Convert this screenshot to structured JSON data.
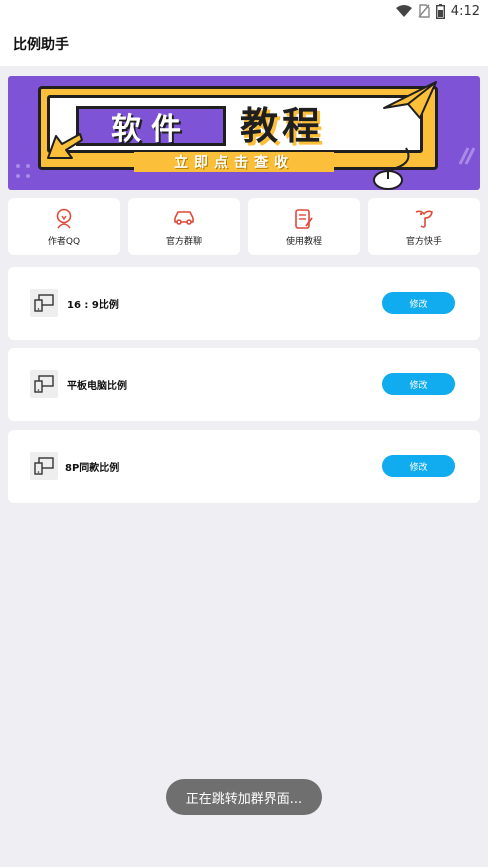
{
  "status_bar": {
    "time": "4:12",
    "icons": [
      "wifi-icon",
      "no-sim-icon",
      "battery-icon"
    ]
  },
  "app_bar": {
    "title": "比例助手"
  },
  "banner": {
    "title_left": "软件",
    "title_right": "教程",
    "cta": "立即点击查收",
    "colors": {
      "background": "#7f53d6",
      "accent": "#fbbf3a"
    }
  },
  "quick_actions": [
    {
      "label": "作者QQ",
      "icon": "user-icon"
    },
    {
      "label": "官方群聊",
      "icon": "car-icon"
    },
    {
      "label": "使用教程",
      "icon": "document-edit-icon"
    },
    {
      "label": "官方快手",
      "icon": "kuaishou-icon"
    }
  ],
  "ratio_items": [
    {
      "title": "16 : 9比例",
      "button": "修改",
      "icon": "devices-icon"
    },
    {
      "title": "平板电脑比例",
      "button": "修改",
      "icon": "devices-icon"
    },
    {
      "title": "8P同款比例",
      "button": "修改",
      "icon": "devices-icon"
    }
  ],
  "toast": {
    "text": "正在跳转加群界面..."
  },
  "colors": {
    "accent_blue": "#10acef",
    "icon_red": "#e04a3a",
    "page_bg": "#efeef3"
  }
}
